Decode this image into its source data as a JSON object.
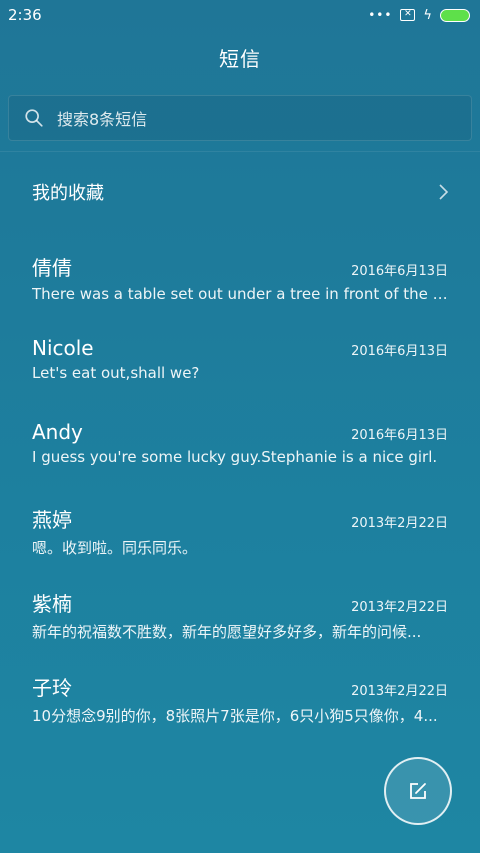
{
  "status_bar": {
    "time": "2:36",
    "dots": "•••",
    "box_glyph": "✕",
    "bolt": "ϟ"
  },
  "header": {
    "title": "短信"
  },
  "search": {
    "placeholder": "搜索8条短信"
  },
  "favorites": {
    "label": "我的收藏"
  },
  "conversations": [
    {
      "name": "倩倩",
      "date": "2016年6月13日",
      "preview": "There was a table set out under a tree in front of the ho..."
    },
    {
      "name": "Nicole",
      "date": "2016年6月13日",
      "preview": "Let's eat out,shall we?"
    },
    {
      "name": "Andy",
      "date": "2016年6月13日",
      "preview": "I guess you're some lucky guy.Stephanie is a nice girl."
    },
    {
      "name": "燕婷",
      "date": "2013年2月22日",
      "preview": "嗯。收到啦。同乐同乐。"
    },
    {
      "name": "紫楠",
      "date": "2013年2月22日",
      "preview": "新年的祝福数不胜数，新年的愿望好多好多，新年的问候..."
    },
    {
      "name": "子玲",
      "date": "2013年2月22日",
      "preview": "10分想念9别的你，8张照片7张是你，6只小狗5只像你，4..."
    }
  ],
  "icons": {
    "search": "search-icon",
    "chevron": "chevron-right-icon",
    "compose": "compose-icon",
    "battery": "battery-icon"
  },
  "colors": {
    "background": "#1e7a9a",
    "battery": "#5ee04a"
  }
}
